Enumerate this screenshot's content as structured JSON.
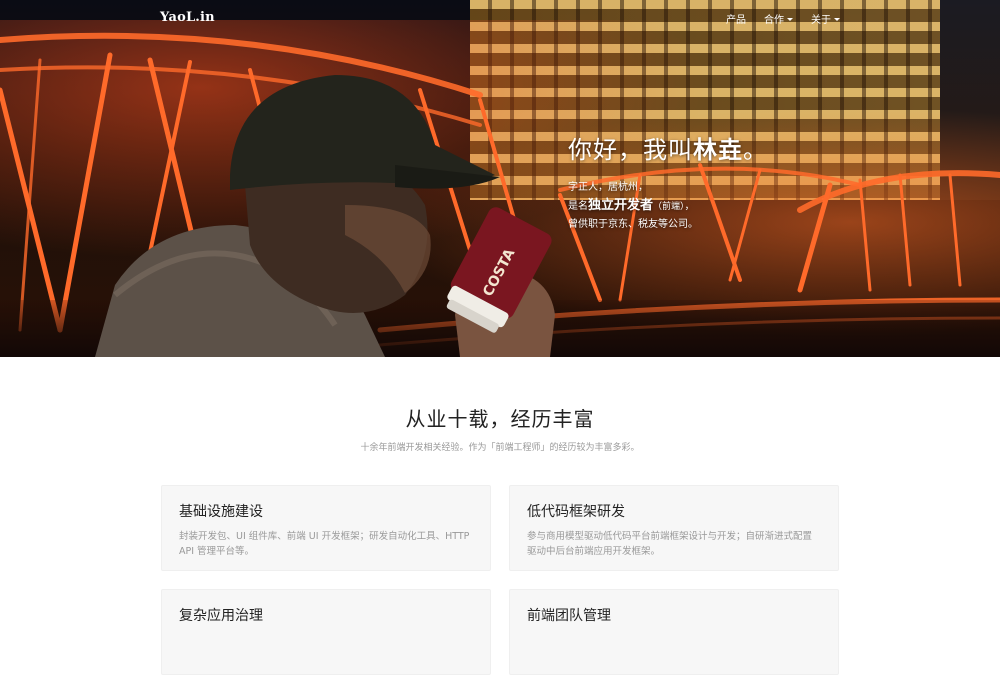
{
  "navbar": {
    "brand": "YaoL.in",
    "items": [
      {
        "label": "产品",
        "dropdown": false
      },
      {
        "label": "合作",
        "dropdown": true
      },
      {
        "label": "关于",
        "dropdown": true
      }
    ]
  },
  "hero": {
    "greeting_prefix": "你好，我叫",
    "name": "林垚",
    "greeting_suffix": "。",
    "line1": "字正人，居杭州，",
    "line2_prefix": "是名",
    "line2_strong": "独立开发者",
    "line2_small": "（前端）",
    "line2_suffix": "，",
    "line3": "曾供职于京东、税友等公司。",
    "cup_text": "COSTA"
  },
  "section": {
    "title": "从业十载，经历丰富",
    "subtitle": "十余年前端开发相关经验。作为「前端工程师」的经历较为丰富多彩。",
    "cards": [
      {
        "title": "基础设施建设",
        "desc": "封装开发包、UI 组件库、前端 UI 开发框架；研发自动化工具、HTTP API 管理平台等。"
      },
      {
        "title": "低代码框架研发",
        "desc": "参与商用模型驱动低代码平台前端框架设计与开发；自研渐进式配置驱动中后台前端应用开发框架。"
      },
      {
        "title": "复杂应用治理",
        "desc": ""
      },
      {
        "title": "前端团队管理",
        "desc": ""
      }
    ]
  },
  "colors": {
    "accent": "#ff6a2a",
    "text_dark": "#222222",
    "text_muted": "#999999",
    "card_bg": "#f7f7f7"
  }
}
